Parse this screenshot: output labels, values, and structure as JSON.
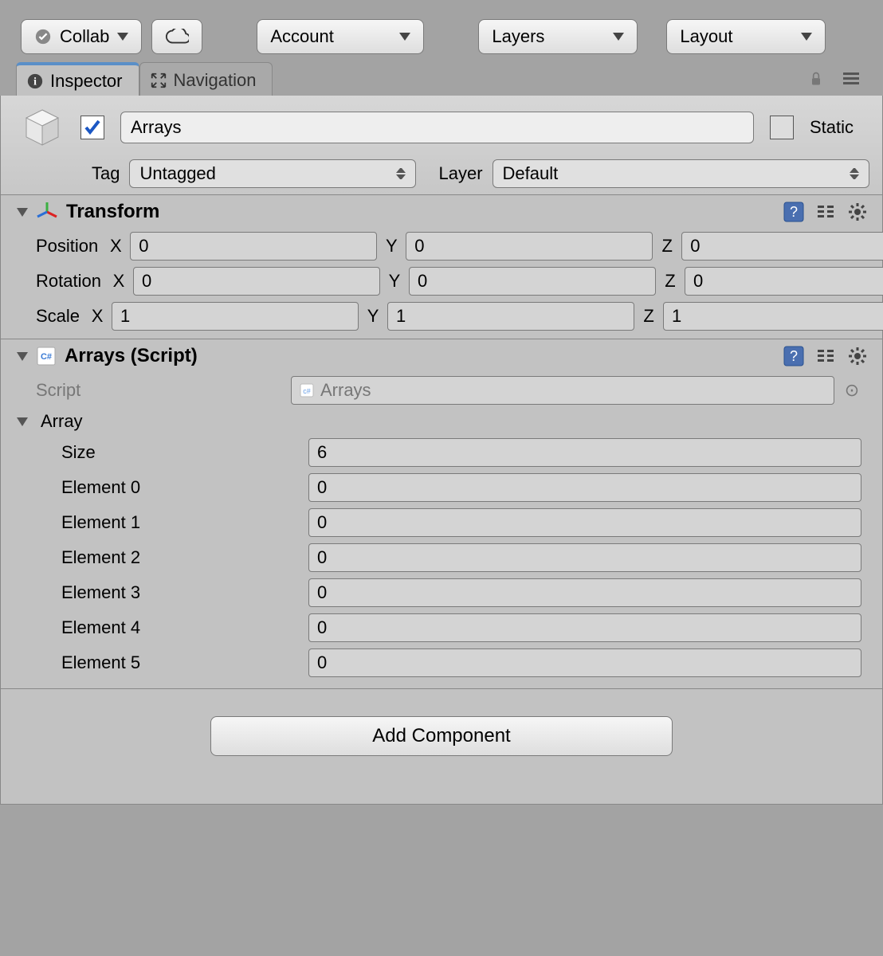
{
  "toolbar": {
    "collab_label": "Collab",
    "account_label": "Account",
    "layers_label": "Layers",
    "layout_label": "Layout"
  },
  "tabs": {
    "inspector_label": "Inspector",
    "navigation_label": "Navigation"
  },
  "object": {
    "name": "Arrays",
    "static_label": "Static",
    "tag_label": "Tag",
    "tag_value": "Untagged",
    "layer_label": "Layer",
    "layer_value": "Default"
  },
  "transform": {
    "title": "Transform",
    "position_label": "Position",
    "rotation_label": "Rotation",
    "scale_label": "Scale",
    "x_label": "X",
    "y_label": "Y",
    "z_label": "Z",
    "position": {
      "x": "0",
      "y": "0",
      "z": "0"
    },
    "rotation": {
      "x": "0",
      "y": "0",
      "z": "0"
    },
    "scale": {
      "x": "1",
      "y": "1",
      "z": "1"
    }
  },
  "script_comp": {
    "title": "Arrays (Script)",
    "script_label": "Script",
    "script_value": "Arrays",
    "array_label": "Array",
    "size_label": "Size",
    "size_value": "6",
    "elements": [
      {
        "label": "Element 0",
        "value": "0"
      },
      {
        "label": "Element 1",
        "value": "0"
      },
      {
        "label": "Element 2",
        "value": "0"
      },
      {
        "label": "Element 3",
        "value": "0"
      },
      {
        "label": "Element 4",
        "value": "0"
      },
      {
        "label": "Element 5",
        "value": "0"
      }
    ]
  },
  "add_component_label": "Add Component"
}
